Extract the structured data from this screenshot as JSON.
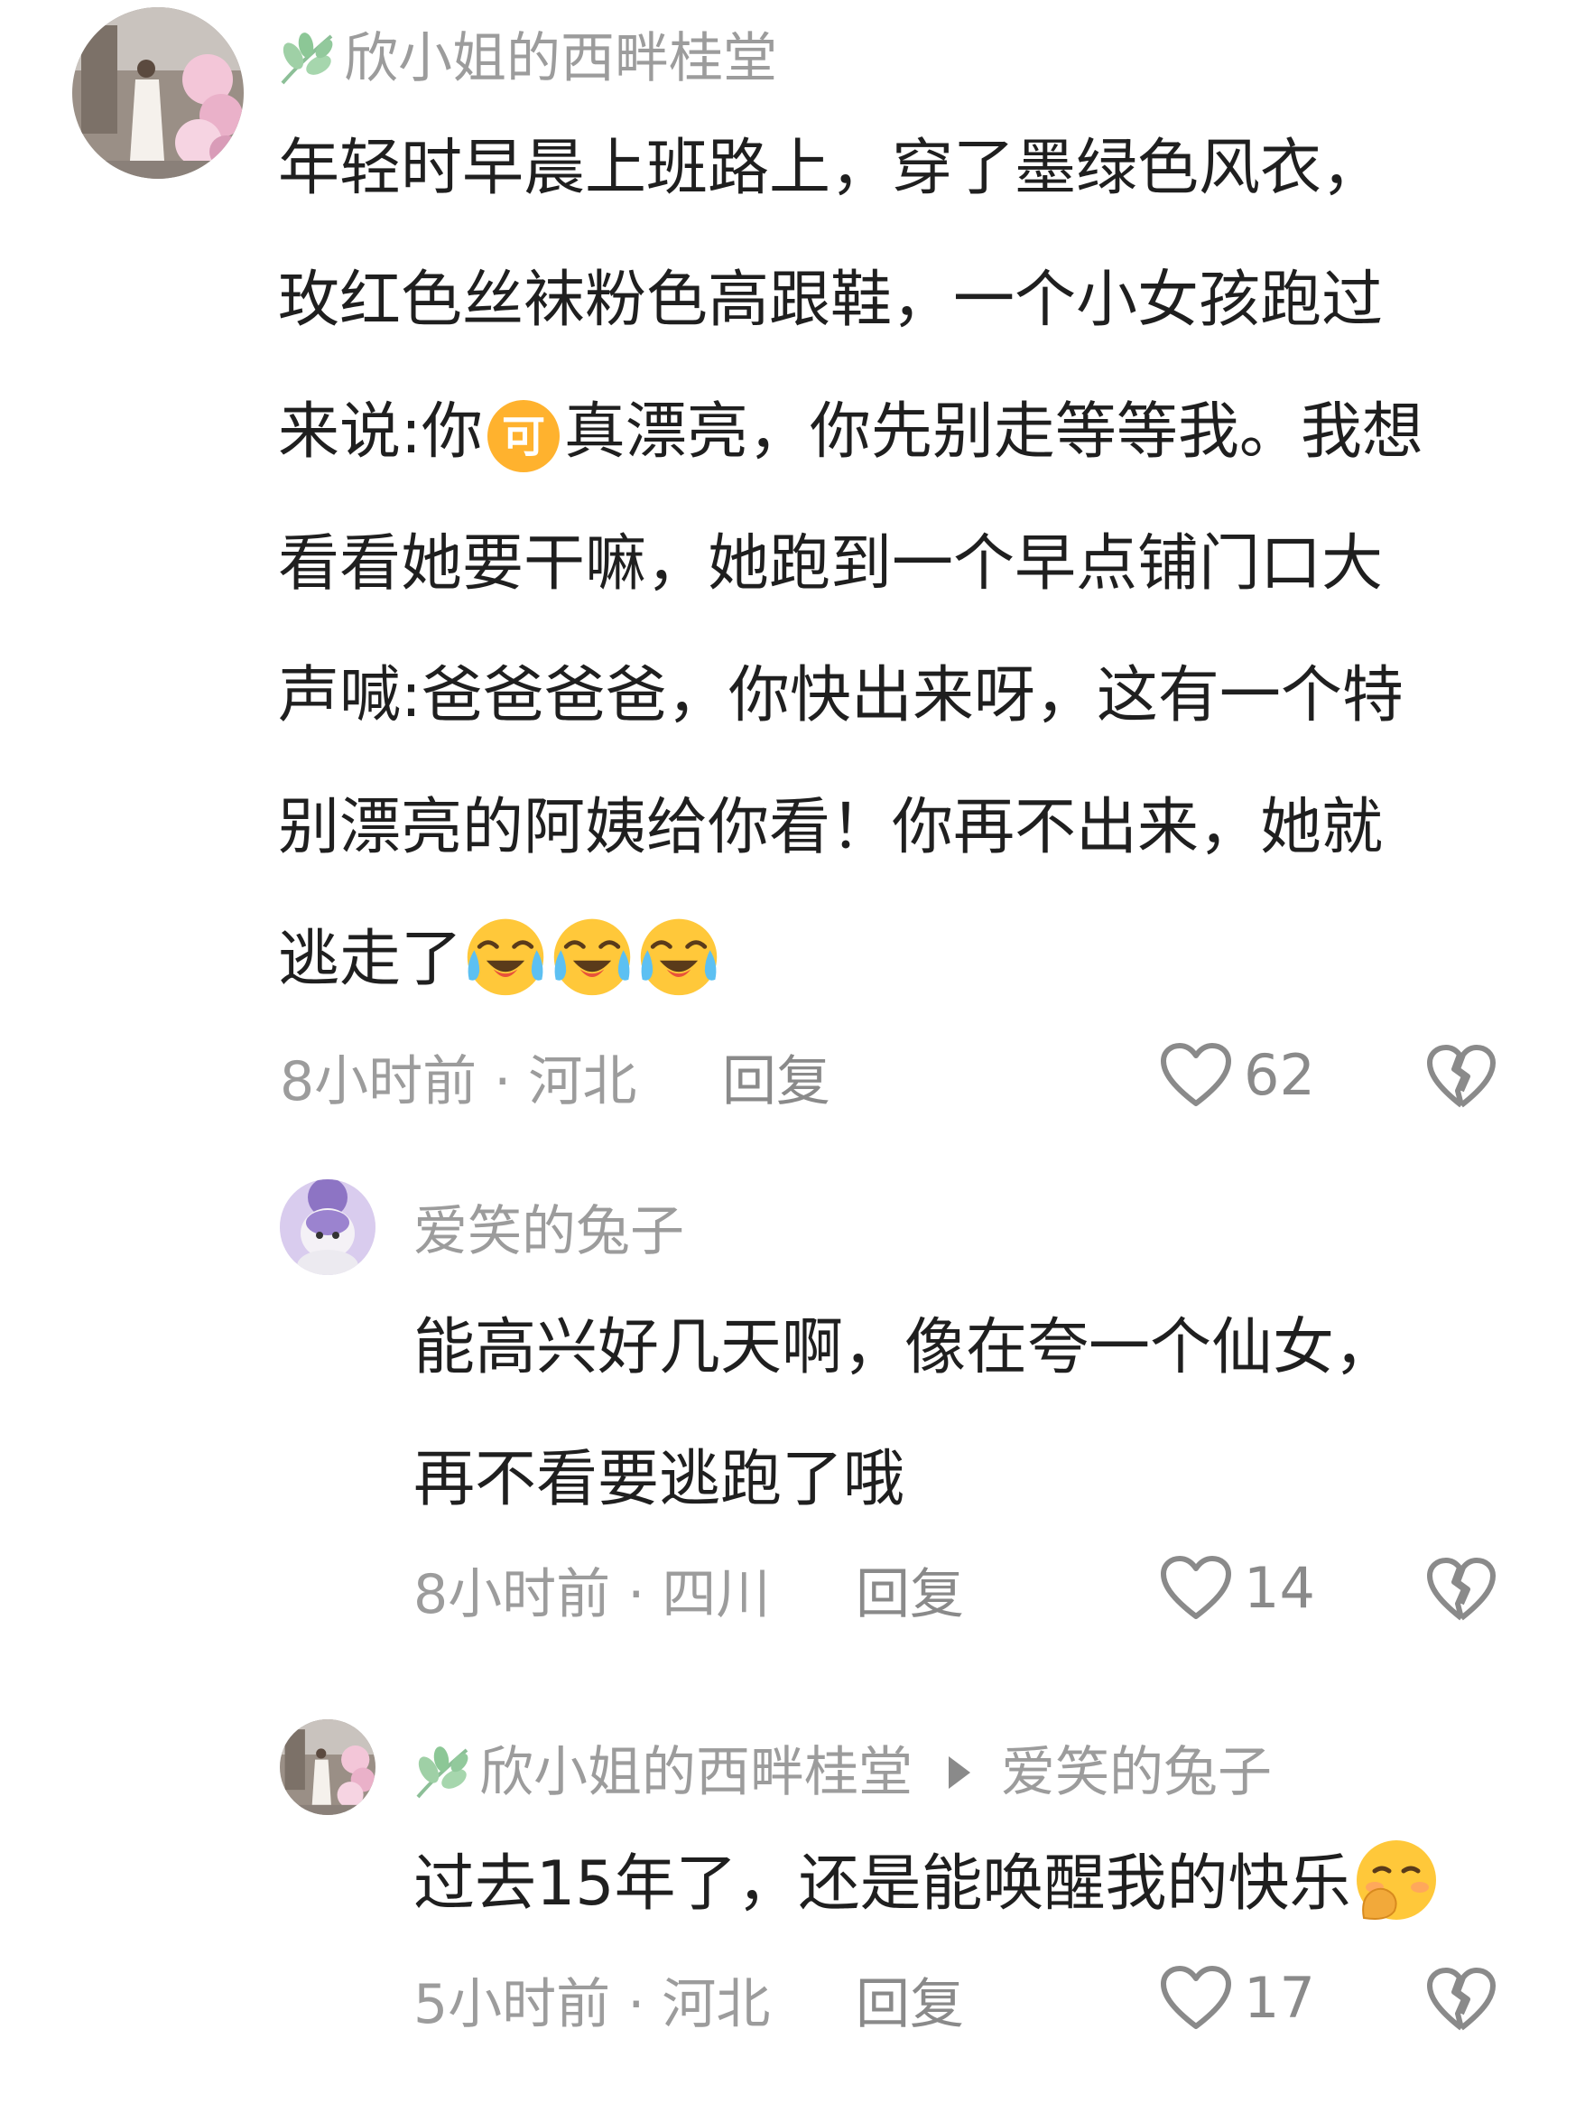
{
  "comment": {
    "author": "欣小姐的西畔桂堂",
    "avatar_icon": "author-avatar-photo",
    "lines": [
      "年轻时早晨上班路上，穿了墨绿色风衣，",
      "玫红色丝袜粉色高跟鞋，一个小女孩跑过",
      "来说:你",
      "真漂亮，你先别走等等我。我想",
      "看看她要干嘛，她跑到一个早点铺门口大",
      "声喊:爸爸爸爸，你快出来呀，这有一个特",
      "别漂亮的阿姨给你看！你再不出来，她就",
      "逃走了"
    ],
    "inline_icon_text": "可",
    "emoji_names": [
      "crying-laughing-emoji",
      "crying-laughing-emoji",
      "crying-laughing-emoji"
    ],
    "time": "8小时前 · 河北",
    "reply_label": "回复",
    "likes": "62"
  },
  "reply1": {
    "author": "爱笑的兔子",
    "avatar_icon": "bunny-avatar",
    "lines": [
      "能高兴好几天啊，像在夸一个仙女，",
      "再不看要逃跑了哦"
    ],
    "time": "8小时前 · 四川",
    "reply_label": "回复",
    "likes": "14"
  },
  "reply2": {
    "author": "欣小姐的西畔桂堂",
    "reply_to": "爱笑的兔子",
    "lines": [
      "过去15年了，还是能唤醒我的快乐"
    ],
    "emoji_name": "blushing-hand-over-mouth-emoji",
    "time": "5小时前 · 河北",
    "reply_label": "回复",
    "likes": "17"
  },
  "colors": {
    "text": "#1f1f1f",
    "meta": "#9c9c9c",
    "icon": "#8a8a8a",
    "leaf": "#7fbf8f",
    "emoji_yellow": "#ffc83a"
  }
}
